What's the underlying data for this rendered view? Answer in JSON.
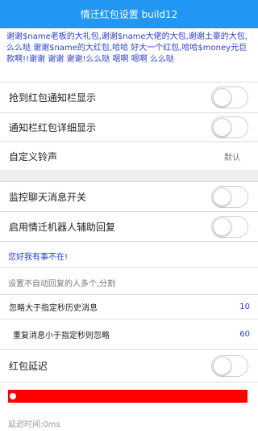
{
  "header": {
    "title": "情迁红包设置 build12",
    "bg_color": "#2196f3"
  },
  "intro": {
    "text": "谢谢$name老板的大礼包,谢谢$name大佬的大包,谢谢土豪的大包,么么哒 谢谢$name的大红包,哈哈 好大一个红包,哈哈$money元巨款啊!!谢谢 谢谢 谢谢!么么哒 嗯啊 嗯啊 么么哒"
  },
  "settings": {
    "grab_notify": {
      "label": "抢到红包通知栏显示",
      "enabled": false
    },
    "notify_detail": {
      "label": "通知栏红包详细显示",
      "enabled": false
    },
    "ringtone": {
      "label": "自定义铃声",
      "value": "默认"
    },
    "monitor_chat": {
      "label": "监控聊天消息开关",
      "enabled": false
    },
    "robot_reply": {
      "label": "启用情迁机器人辅助回复",
      "enabled": false
    },
    "robot_message": "您好我有事不在!",
    "no_reply_hint": "设置不自动回复的人多个,分割",
    "ignore_history": {
      "label": "忽略大于指定秒历史消息",
      "value": "10"
    },
    "repeat_ignore": {
      "label": "重复消息小于指定秒则忽略",
      "value": "60"
    },
    "redpacket_delay": {
      "label": "红包延迟",
      "enabled": false
    },
    "delay_slider": {
      "value": 0,
      "color": "#ff0000"
    },
    "delay_text": "延迟时间:0ms"
  }
}
